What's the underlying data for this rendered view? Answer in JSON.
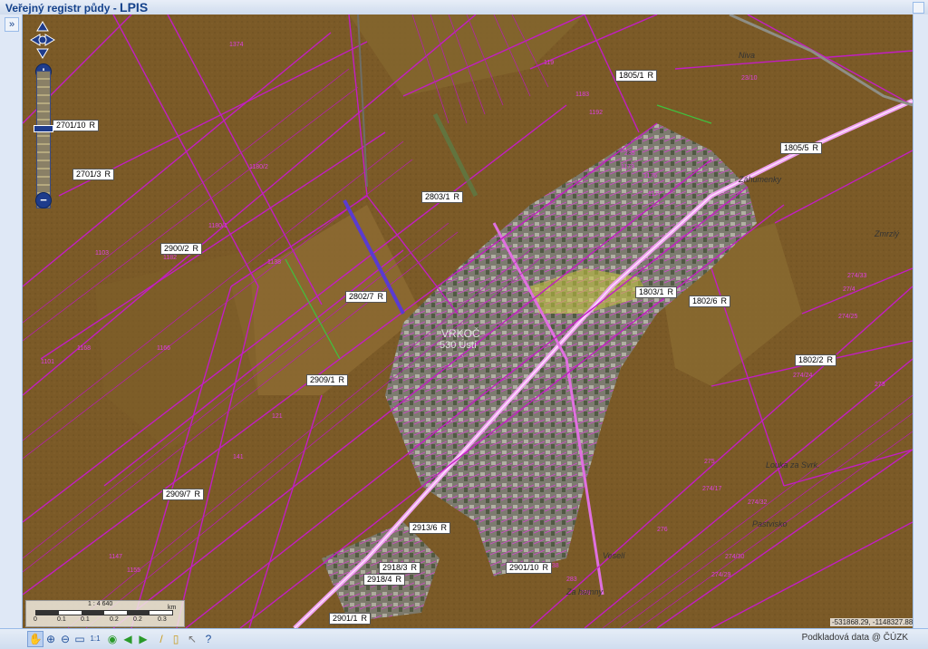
{
  "app": {
    "title_prefix": "Veřejný registr půdy - ",
    "title_brand": "LPIS"
  },
  "sidebar": {
    "expand_label": "»"
  },
  "map": {
    "parcel_labels": [
      {
        "text": "2701/10",
        "suffix": "R"
      },
      {
        "text": "2701/3",
        "suffix": "R"
      },
      {
        "text": "2900/2",
        "suffix": "R"
      },
      {
        "text": "2802/7",
        "suffix": "R"
      },
      {
        "text": "2909/1",
        "suffix": "R"
      },
      {
        "text": "2909/7",
        "suffix": "R"
      },
      {
        "text": "2803/1",
        "suffix": "R"
      },
      {
        "text": "1803/1",
        "suffix": "R"
      },
      {
        "text": "1802/6",
        "suffix": "R"
      },
      {
        "text": "1802/2",
        "suffix": "R"
      },
      {
        "text": "1805/1",
        "suffix": "R"
      },
      {
        "text": "1805/5",
        "suffix": "R"
      },
      {
        "text": "2913/6",
        "suffix": "R"
      },
      {
        "text": "2918/3",
        "suffix": "R"
      },
      {
        "text": "2918/4",
        "suffix": "R"
      },
      {
        "text": "2901/10",
        "suffix": "R"
      },
      {
        "text": "2901/1",
        "suffix": "R"
      }
    ],
    "place_names": [
      "Niva",
      "Zmrzlý",
      "Louka za Svrk.",
      "Pastvisko",
      "Záhumenky",
      "Veselí",
      "Za humny"
    ],
    "town_label": "VRKOČ",
    "town_code": "530 Ústí",
    "magenta_numbers": [
      "1374",
      "119",
      "1180/2",
      "1180/1",
      "1182",
      "1183",
      "1192",
      "1166",
      "1168",
      "1101",
      "1103",
      "1138",
      "121",
      "141",
      "1147",
      "1155",
      "23/10",
      "27/4",
      "274/25",
      "274/24",
      "274/32",
      "274/29",
      "274/30",
      "274/17",
      "274/33",
      "273",
      "275",
      "276",
      "283",
      "238",
      "236",
      "235",
      "1173",
      "1176",
      "1177"
    ]
  },
  "scale": {
    "ratio": "1 : 4 640",
    "unit": "km",
    "ticks": [
      "0",
      "0.1",
      "0.1",
      "0.2",
      "0.2",
      "0.3"
    ]
  },
  "coordinates": "-531868.29, -1148327.88",
  "footer": {
    "credit": "Podkladová data @ ČÚZK"
  },
  "toolbar": [
    {
      "icon": "pan-hand-icon"
    },
    {
      "icon": "zoom-in-icon"
    },
    {
      "icon": "zoom-out-icon"
    },
    {
      "icon": "zoom-box-icon"
    },
    {
      "icon": "zoom-1to1-icon"
    },
    {
      "icon": "refresh-icon"
    },
    {
      "icon": "back-icon"
    },
    {
      "icon": "forward-icon"
    },
    {
      "icon": "measure-icon"
    },
    {
      "icon": "identify-icon"
    },
    {
      "icon": "select-icon"
    },
    {
      "icon": "help-icon"
    }
  ],
  "colors": {
    "parcel_line": "#d020d0",
    "field": "#7a5a26",
    "urban": "#8a8a84",
    "accent": "#15428b"
  }
}
